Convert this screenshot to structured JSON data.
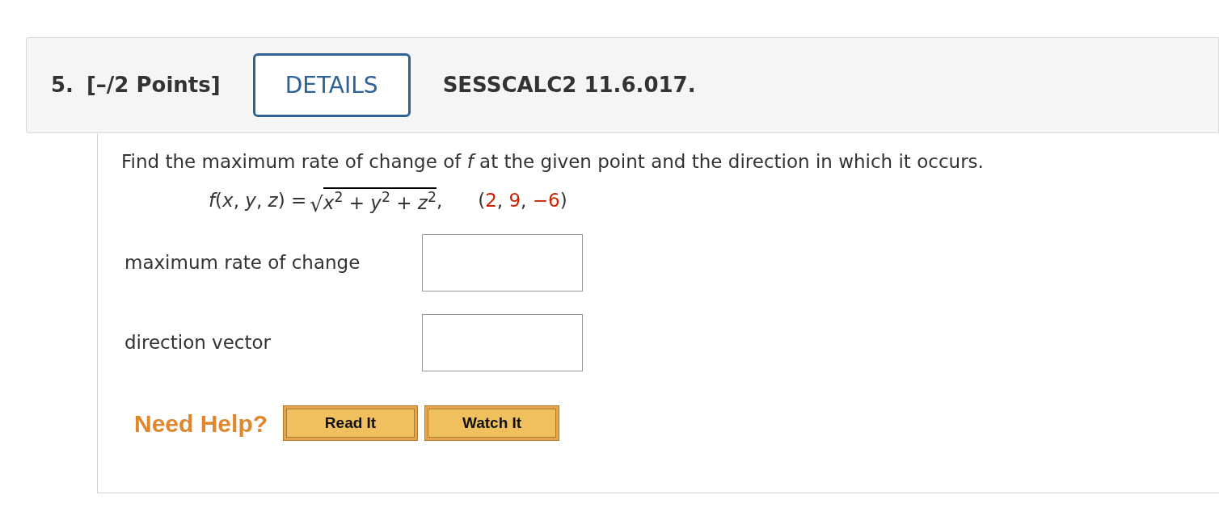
{
  "question": {
    "number": "5.",
    "points": "[–/2 Points]",
    "details_button": "DETAILS",
    "code": "SESSCALC2 11.6.017."
  },
  "prompt": "Find the maximum rate of change of *f* at the given point and the direction in which it occurs.",
  "formula": {
    "lhs": "*f*(*x*, *y*, *z*) = ",
    "radical_sign": "√",
    "radicand": "*x*$^{2}$ + *y*$^{2}$ + *z*$^{2}$",
    "trail": ",",
    "point": [
      {
        "kind": "punct",
        "text": "("
      },
      {
        "kind": "value",
        "text": "2"
      },
      {
        "kind": "punct",
        "text": ", "
      },
      {
        "kind": "value",
        "text": "9"
      },
      {
        "kind": "punct",
        "text": ", "
      },
      {
        "kind": "value",
        "text": "−6"
      },
      {
        "kind": "punct",
        "text": ")"
      }
    ]
  },
  "answers": [
    {
      "label": "maximum rate of change"
    },
    {
      "label": "direction vector"
    }
  ],
  "help": {
    "label": "Need Help?",
    "buttons": [
      "Read It",
      "Watch It"
    ]
  }
}
